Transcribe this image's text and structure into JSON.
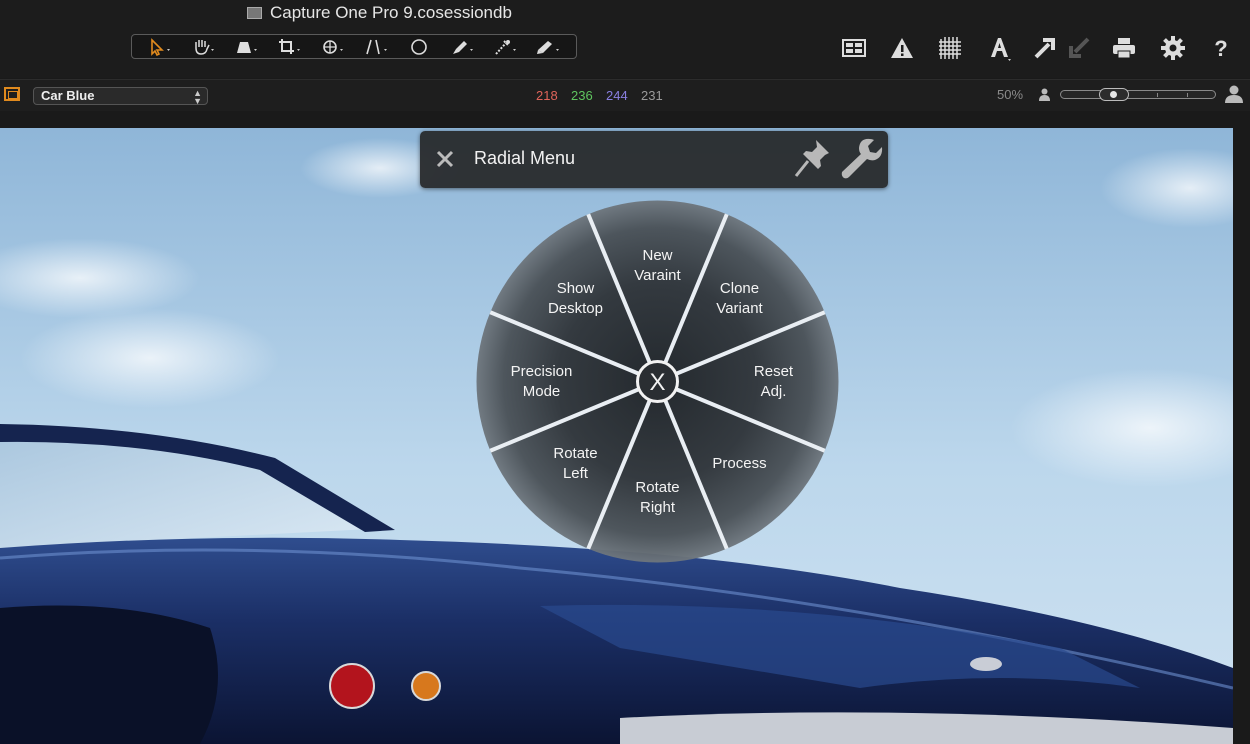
{
  "window": {
    "title": "Capture One Pro 9.cosessiondb"
  },
  "toolbar": {
    "tools": [
      {
        "name": "select-tool-icon"
      },
      {
        "name": "pan-tool-icon"
      },
      {
        "name": "loupe-tool-icon"
      },
      {
        "name": "crop-tool-icon"
      },
      {
        "name": "rotate-tool-icon"
      },
      {
        "name": "keystone-tool-icon"
      },
      {
        "name": "spot-removal-tool-icon"
      },
      {
        "name": "draw-mask-tool-icon"
      },
      {
        "name": "picker-tool-icon"
      },
      {
        "name": "annotate-tool-icon"
      }
    ],
    "right_icons": [
      "grid-view-icon",
      "exposure-warning-icon",
      "overlay-grid-icon",
      "text-tool-icon",
      "copy-adjustments-icon",
      "apply-adjustments-icon",
      "print-icon",
      "settings-icon",
      "help-icon"
    ]
  },
  "viewer_bar": {
    "preset": "Car Blue",
    "rgb": {
      "r": "218",
      "g": "236",
      "b": "244",
      "l": "231"
    },
    "colors": {
      "r": "#e0645a",
      "g": "#5fc45f",
      "b": "#8a7fe0",
      "l": "#9a9a9a",
      "accent": "#e08a1e"
    },
    "zoom": "50%",
    "zoom_slider_level": 0.3
  },
  "radial_menu": {
    "title": "Radial Menu",
    "close_icon": "close-icon",
    "pin_icon": "pin-icon",
    "wrench_icon": "wrench-icon",
    "center_label": "X",
    "segments": [
      {
        "key": "new-variant",
        "label": "New\nVaraint"
      },
      {
        "key": "clone-variant",
        "label": "Clone\nVariant"
      },
      {
        "key": "reset-adj",
        "label": "Reset\nAdj."
      },
      {
        "key": "process",
        "label": "Process"
      },
      {
        "key": "rotate-right",
        "label": "Rotate\nRight"
      },
      {
        "key": "rotate-left",
        "label": "Rotate\nLeft"
      },
      {
        "key": "precision-mode",
        "label": "Precision\nMode"
      },
      {
        "key": "show-desktop",
        "label": "Show\nDesktop"
      }
    ]
  }
}
